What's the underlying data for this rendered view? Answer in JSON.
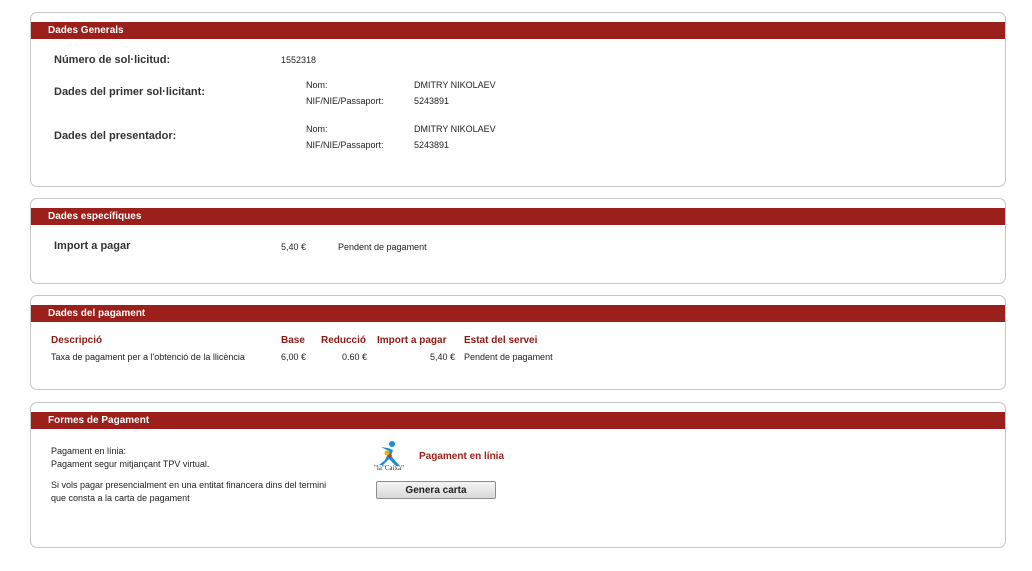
{
  "general": {
    "header": "Dades Generals",
    "request_number_label": "Número de sol·licitud:",
    "request_number": "1552318",
    "first_applicant_label": "Dades del primer sol·licitant:",
    "first_applicant": {
      "name_label": "Nom:",
      "name": "DMITRY NIKOLAEV",
      "id_label": "NIF/NIE/Passaport:",
      "id": "5243891"
    },
    "presenter_label": "Dades del presentador:",
    "presenter": {
      "name_label": "Nom:",
      "name": "DMITRY NIKOLAEV",
      "id_label": "NIF/NIE/Passaport:",
      "id": "5243891"
    }
  },
  "specific": {
    "header": "Dades específiques",
    "amount_label": "Import a pagar",
    "amount": "5,40 €",
    "status": "Pendent de pagament"
  },
  "payment": {
    "header": "Dades del pagament",
    "columns": [
      "Descripció",
      "Base",
      "Reducció",
      "Import a pagar",
      "Estat del servei"
    ],
    "rows": [
      [
        "Taxa de pagament per a l'obtenció de la llicència",
        "6,00 €",
        "0.60 €",
        "5,40 €",
        "Pendent de pagament"
      ]
    ]
  },
  "methods": {
    "header": "Formes de Pagament",
    "online_line1": "Pagament en línia:",
    "online_line2": "Pagament segur mitjançant TPV virtual.",
    "online_link": "Pagament en línia",
    "logo_text": "\"la\"Caixa\"",
    "offline_line1": "Si vols pagar presencialment en una entitat financera dins del termini",
    "offline_line2": "que consta a la carta de pagament",
    "generate_button": "Genera carta",
    "logo_colors": {
      "star": "#1a8fd6",
      "text": "#333333"
    }
  }
}
